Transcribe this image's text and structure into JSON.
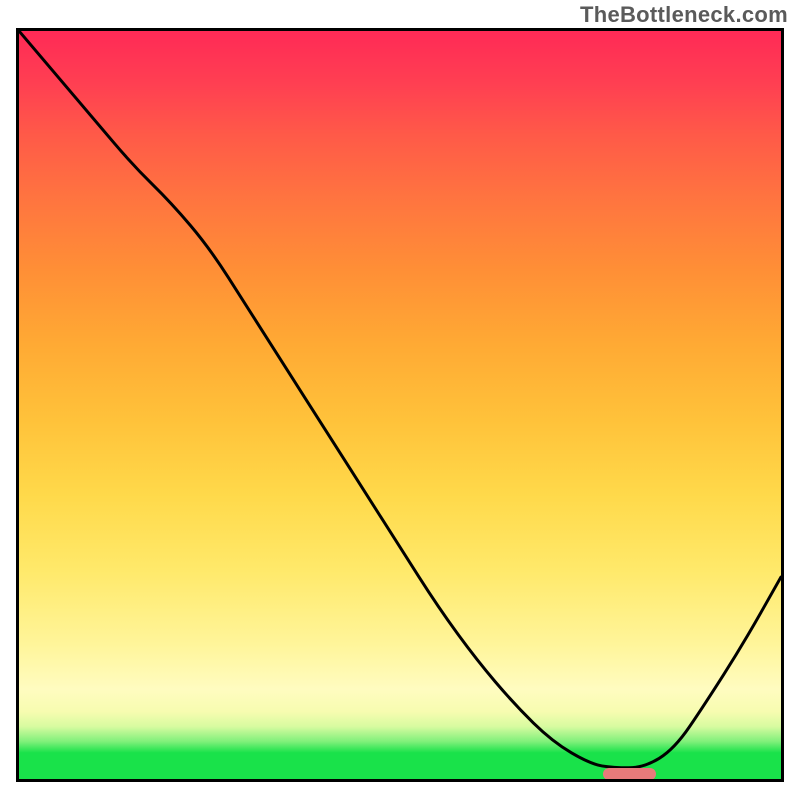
{
  "watermark": "TheBottleneck.com",
  "chart_data": {
    "type": "line",
    "title": "",
    "xlabel": "",
    "ylabel": "",
    "xlim": [
      0,
      100
    ],
    "ylim": [
      0,
      100
    ],
    "x": [
      0,
      5,
      10,
      15,
      20,
      25,
      30,
      35,
      40,
      45,
      50,
      55,
      60,
      65,
      70,
      75,
      78,
      82,
      86,
      90,
      95,
      100
    ],
    "values": [
      100,
      94,
      88,
      82,
      77,
      71,
      63,
      55,
      47,
      39,
      31,
      23,
      16,
      10,
      5,
      2,
      1.5,
      1.5,
      4,
      10,
      18,
      27
    ],
    "marker": {
      "x_start": 76,
      "x_end": 83,
      "y": 1.5
    },
    "gradient_stops": [
      {
        "pos": 0,
        "color": "#19e24a"
      },
      {
        "pos": 4,
        "color": "#19e24a"
      },
      {
        "pos": 8,
        "color": "#f7fcb0"
      },
      {
        "pos": 50,
        "color": "#ffc23a"
      },
      {
        "pos": 100,
        "color": "#ff2a56"
      }
    ]
  }
}
